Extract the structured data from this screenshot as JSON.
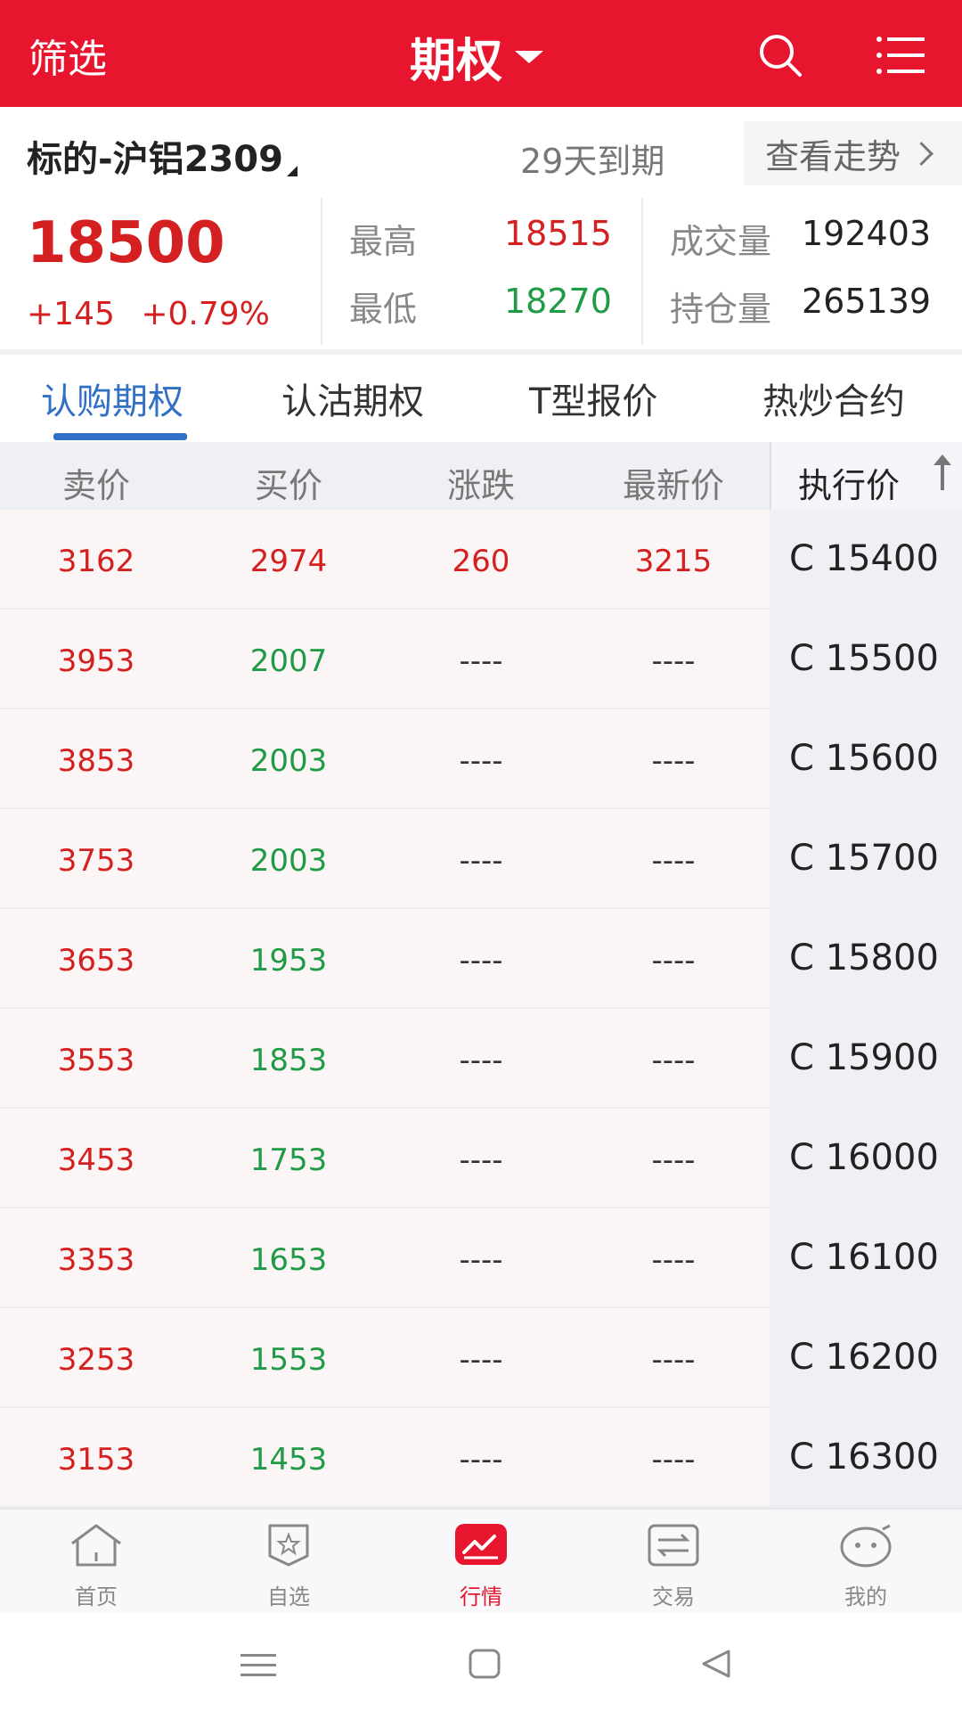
{
  "topbar": {
    "filter_label": "筛选",
    "title": "期权",
    "search_icon": "search-icon",
    "menu_icon": "menu-icon"
  },
  "underlying": {
    "name": "标的-沪铝2309",
    "expiry": "29天到期",
    "trend_link": "查看走势"
  },
  "quote": {
    "last_price": "18500",
    "change": "+145",
    "change_pct": "+0.79%",
    "high_label": "最高",
    "high_value": "18515",
    "low_label": "最低",
    "low_value": "18270",
    "volume_label": "成交量",
    "volume_value": "192403",
    "open_interest_label": "持仓量",
    "open_interest_value": "265139"
  },
  "tabs": [
    {
      "label": "认购期权",
      "active": true
    },
    {
      "label": "认沽期权",
      "active": false
    },
    {
      "label": "T型报价",
      "active": false
    },
    {
      "label": "热炒合约",
      "active": false
    }
  ],
  "table": {
    "headers": [
      "卖价",
      "买价",
      "涨跌",
      "最新价",
      "执行价"
    ],
    "rows": [
      {
        "ask": "3162",
        "bid": "2974",
        "change": "260",
        "last": "3215",
        "strike": "C 15400",
        "bid_color": "red"
      },
      {
        "ask": "3953",
        "bid": "2007",
        "change": "----",
        "last": "----",
        "strike": "C 15500",
        "bid_color": "green"
      },
      {
        "ask": "3853",
        "bid": "2003",
        "change": "----",
        "last": "----",
        "strike": "C 15600",
        "bid_color": "green"
      },
      {
        "ask": "3753",
        "bid": "2003",
        "change": "----",
        "last": "----",
        "strike": "C 15700",
        "bid_color": "green"
      },
      {
        "ask": "3653",
        "bid": "1953",
        "change": "----",
        "last": "----",
        "strike": "C 15800",
        "bid_color": "green"
      },
      {
        "ask": "3553",
        "bid": "1853",
        "change": "----",
        "last": "----",
        "strike": "C 15900",
        "bid_color": "green"
      },
      {
        "ask": "3453",
        "bid": "1753",
        "change": "----",
        "last": "----",
        "strike": "C 16000",
        "bid_color": "green"
      },
      {
        "ask": "3353",
        "bid": "1653",
        "change": "----",
        "last": "----",
        "strike": "C 16100",
        "bid_color": "green"
      },
      {
        "ask": "3253",
        "bid": "1553",
        "change": "----",
        "last": "----",
        "strike": "C 16200",
        "bid_color": "green"
      },
      {
        "ask": "3153",
        "bid": "1453",
        "change": "----",
        "last": "----",
        "strike": "C 16300",
        "bid_color": "green"
      }
    ]
  },
  "bottom_nav": [
    {
      "label": "首页",
      "icon": "home-icon",
      "active": false
    },
    {
      "label": "自选",
      "icon": "star-badge-icon",
      "active": false
    },
    {
      "label": "行情",
      "icon": "market-chart-icon",
      "active": true
    },
    {
      "label": "交易",
      "icon": "exchange-icon",
      "active": false
    },
    {
      "label": "我的",
      "icon": "profile-face-icon",
      "active": false
    }
  ],
  "colors": {
    "brand_red": "#e8152f",
    "price_up": "#d42020",
    "price_down": "#1f9a45",
    "tab_active": "#3170c4"
  }
}
